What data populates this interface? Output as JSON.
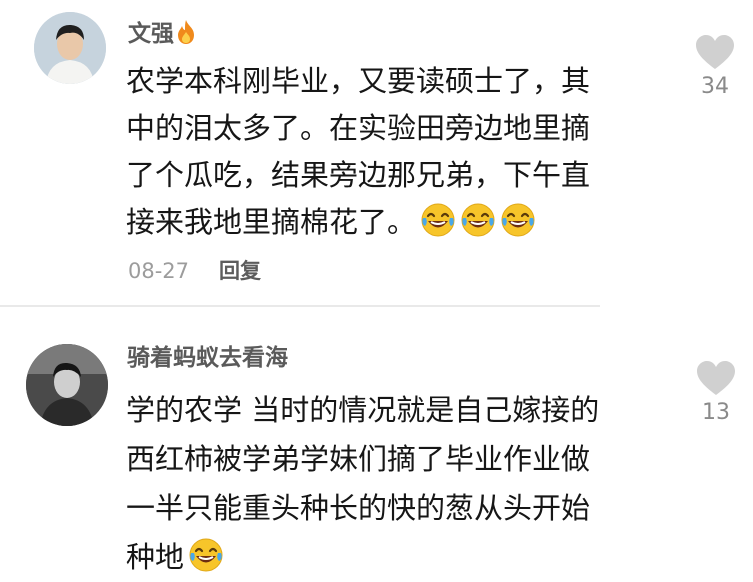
{
  "comments": [
    {
      "username": "文强",
      "username_badge": "fire-icon",
      "lines": [
        "农学本科刚毕业，又要读硕士了，其",
        "中的泪太多了。在实验田旁边地里摘",
        "了个瓜吃，结果旁边那兄弟，下午直",
        "接来我地里摘棉花了。"
      ],
      "emojis": [
        "laugh-cry-emoji",
        "laugh-cry-emoji",
        "laugh-cry-emoji"
      ],
      "date": "08-27",
      "reply_label": "回复",
      "like_count": "34"
    },
    {
      "username": "骑着蚂蚁去看海",
      "lines": [
        "学的农学 当时的情况就是自己嫁接的",
        "西红柿被学弟学妹们摘了毕业作业做",
        "一半只能重头种长的快的葱从头开始",
        "种地"
      ],
      "emojis": [
        "laugh-cry-emoji"
      ],
      "like_count": "13"
    }
  ],
  "colors": {
    "like_heart": "#d0d0d0",
    "emoji_face": "#f7c52a"
  }
}
